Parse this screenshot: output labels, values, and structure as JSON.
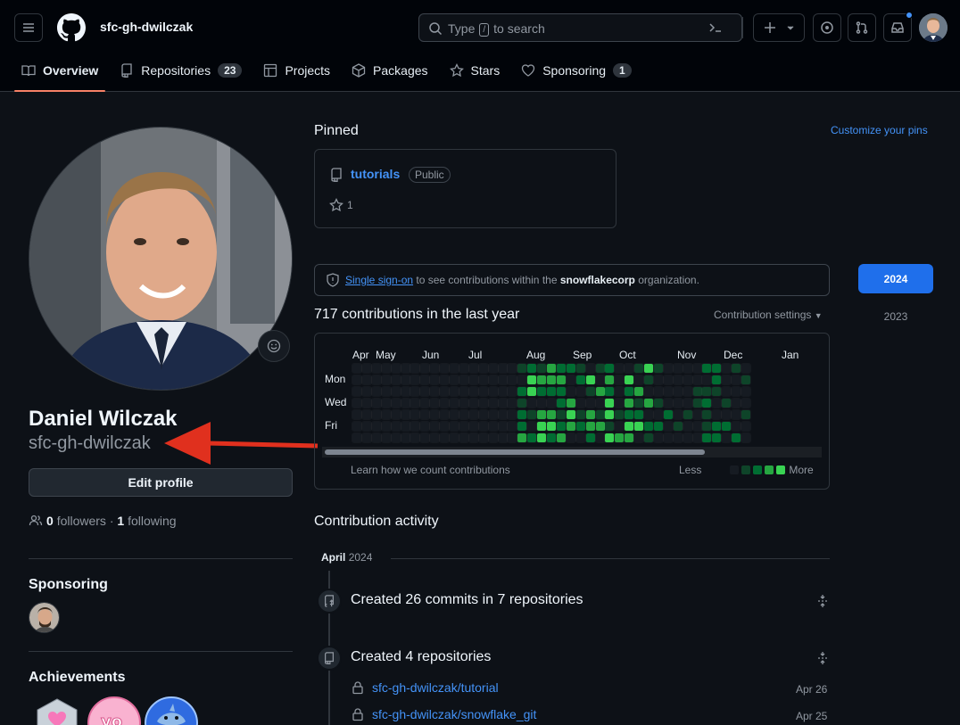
{
  "header": {
    "username": "sfc-gh-dwilczak",
    "search_prefix": "Type",
    "search_key": "/",
    "search_suffix": "to search"
  },
  "tabs": [
    {
      "label": "Overview",
      "count": null
    },
    {
      "label": "Repositories",
      "count": "23"
    },
    {
      "label": "Projects",
      "count": null
    },
    {
      "label": "Packages",
      "count": null
    },
    {
      "label": "Stars",
      "count": null
    },
    {
      "label": "Sponsoring",
      "count": "1"
    }
  ],
  "profile": {
    "full_name": "Daniel Wilczak",
    "username": "sfc-gh-dwilczak",
    "edit_label": "Edit profile",
    "followers": "0",
    "followers_label": "followers",
    "sep": "·",
    "following": "1",
    "following_label": "following"
  },
  "sidebar": {
    "sponsoring_title": "Sponsoring",
    "achievements_title": "Achievements"
  },
  "pinned": {
    "title": "Pinned",
    "customize": "Customize your pins",
    "repo": "tutorials",
    "visibility": "Public",
    "stars": "1"
  },
  "sso": {
    "link": "Single sign-on",
    "text1": "to see contributions within the",
    "org": "snowflakecorp",
    "text2": "organization."
  },
  "years": [
    "2024",
    "2023"
  ],
  "contributions": {
    "heading": "717 contributions in the last year",
    "settings": "Contribution settings",
    "months": [
      "Apr",
      "May",
      "Jun",
      "Jul",
      "Aug",
      "Sep",
      "Oct",
      "Nov",
      "Dec",
      "Jan"
    ],
    "days": [
      "Mon",
      "Wed",
      "Fri"
    ],
    "learn": "Learn how we count contributions",
    "less": "Less",
    "more": "More"
  },
  "activity": {
    "title": "Contribution activity",
    "month": "April",
    "year": "2024",
    "items": [
      {
        "title": "Created 26 commits in 7 repositories"
      },
      {
        "title": "Created 4 repositories"
      }
    ],
    "repos": [
      {
        "name": "sfc-gh-dwilczak/tutorial",
        "date": "Apr 26"
      },
      {
        "name": "sfc-gh-dwilczak/snowflake_git",
        "date": "Apr 25"
      }
    ]
  },
  "colors": {
    "accent": "#4493f8",
    "tab_underline": "#f78166",
    "year_active": "#1f6feb",
    "annotation_arrow": "#e0301e",
    "green_levels": [
      "#161b22",
      "#0e4429",
      "#006d32",
      "#26a641",
      "#39d353"
    ]
  },
  "icons": [
    "hamburger-icon",
    "github-logo-icon",
    "search-icon",
    "command-palette-icon",
    "plus-icon",
    "issues-icon",
    "pull-requests-icon",
    "inbox-icon",
    "book-icon",
    "repo-icon",
    "table-icon",
    "package-icon",
    "star-icon",
    "heart-icon",
    "smiley-icon",
    "people-icon",
    "shield-icon",
    "lock-icon",
    "fold-icon"
  ]
}
